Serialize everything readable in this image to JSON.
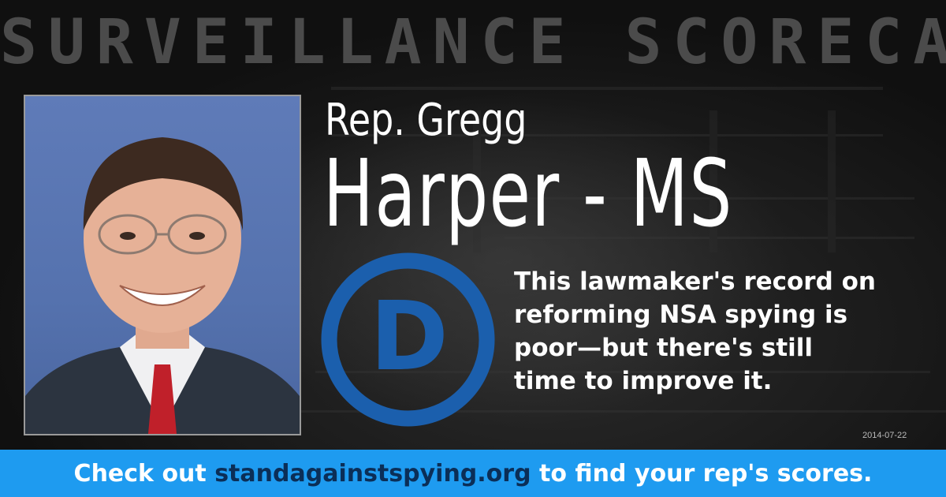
{
  "header": {
    "title": "SURVEILLANCE SCORECARD"
  },
  "representative": {
    "first_line": "Rep. Gregg",
    "second_line": "Harper - MS",
    "party_letter": "D"
  },
  "message": {
    "lines": [
      "This lawmaker's record on",
      "reforming NSA spying is",
      "poor—but there's still",
      "time to improve it."
    ]
  },
  "date": "2014-07-22",
  "footer": {
    "prefix": "Check out ",
    "link": "standagainstspying.org",
    "suffix": " to find your rep's scores."
  },
  "colors": {
    "footer_bg": "#1e9bf0",
    "link": "#0b2e57",
    "party_blue": "#1b5fad",
    "header_text": "#4b4b4b"
  },
  "icons": {
    "party": "democratic-party-logo"
  }
}
